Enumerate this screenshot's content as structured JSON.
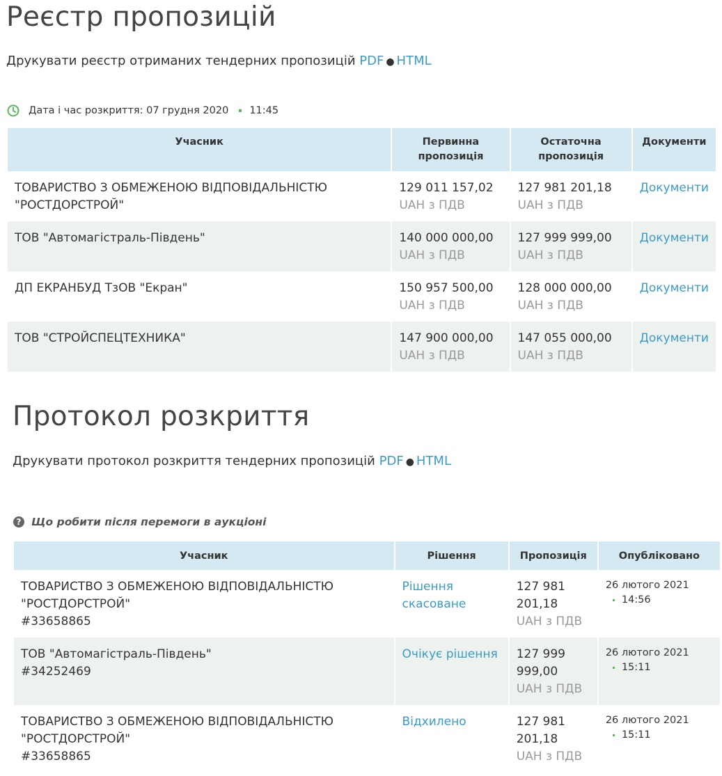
{
  "registry": {
    "title": "Реєстр пропозицій",
    "print_text": "Друкувати реєстр отриманих тендерних пропозицій",
    "pdf_label": "PDF",
    "html_label": "HTML",
    "opening_label": "Дата і час розкриття: 07 грудня 2020",
    "opening_time": "11:45",
    "headers": {
      "participant": "Учасник",
      "initial": "Первинна пропозиція",
      "final": "Остаточна пропозиція",
      "documents": "Документи"
    },
    "rows": [
      {
        "participant": "ТОВАРИСТВО З ОБМЕЖЕНОЮ ВІДПОВІДАЛЬНІСТЮ \"РОСТДОРСТРОЙ\"",
        "initial": "129 011 157,02",
        "initial_vat": "UAH з ПДВ",
        "final": "127 981 201,18",
        "final_vat": "UAH з ПДВ",
        "documents": "Документи"
      },
      {
        "participant": "ТОВ \"Автомагістраль-Південь\"",
        "initial": "140 000 000,00",
        "initial_vat": "UAH з ПДВ",
        "final": "127 999 999,00",
        "final_vat": "UAH з ПДВ",
        "documents": "Документи"
      },
      {
        "participant": "ДП ЕКРАНБУД ТзОВ \"Екран\"",
        "initial": "150 957 500,00",
        "initial_vat": "UAH з ПДВ",
        "final": "128 000 000,00",
        "final_vat": "UAH з ПДВ",
        "documents": "Документи"
      },
      {
        "participant": "ТОВ \"СТРОЙСПЕЦТЕХНИКА\"",
        "initial": "147 900 000,00",
        "initial_vat": "UAH з ПДВ",
        "final": "147 055 000,00",
        "final_vat": "UAH з ПДВ",
        "documents": "Документи"
      }
    ]
  },
  "protocol": {
    "title": "Протокол розкриття",
    "print_text": "Друкувати протокол розкриття тендерних пропозицій",
    "pdf_label": "PDF",
    "html_label": "HTML",
    "help_icon": "question-circle-icon",
    "help_link": "Що робити після перемоги в аукціоні",
    "headers": {
      "participant": "Учасник",
      "decision": "Рішення",
      "offer": "Пропозиція",
      "published": "Опубліковано"
    },
    "rows": [
      {
        "participant": "ТОВАРИСТВО З ОБМЕЖЕНОЮ ВІДПОВІДАЛЬНІСТЮ \"РОСТДОРСТРОЙ\"",
        "code": "#33658865",
        "decision": "Рішення скасоване",
        "offer_line1": "127 981",
        "offer_line2": "201,18",
        "offer_vat": "UAH з ПДВ",
        "date": "26 лютого 2021",
        "time": "14:56"
      },
      {
        "participant": "ТОВ \"Автомагістраль-Південь\"",
        "code": "#34252469",
        "decision": "Очікує рішення",
        "offer_line1": "127 999",
        "offer_line2": "999,00",
        "offer_vat": "UAH з ПДВ",
        "date": "26 лютого 2021",
        "time": "15:11"
      },
      {
        "participant": "ТОВАРИСТВО З ОБМЕЖЕНОЮ ВІДПОВІДАЛЬНІСТЮ \"РОСТДОРСТРОЙ\"",
        "code": "#33658865",
        "decision": "Відхилено",
        "offer_line1": "127 981",
        "offer_line2": "201,18",
        "offer_vat": "UAH з ПДВ",
        "date": "26 лютого 2021",
        "time": "15:11"
      }
    ]
  },
  "colors": {
    "link": "#3a9bc8",
    "header_bg": "#d4e9f2",
    "alt_row_bg": "#eef2ef",
    "muted_text": "#999999",
    "accent_green": "#5cb85c"
  }
}
